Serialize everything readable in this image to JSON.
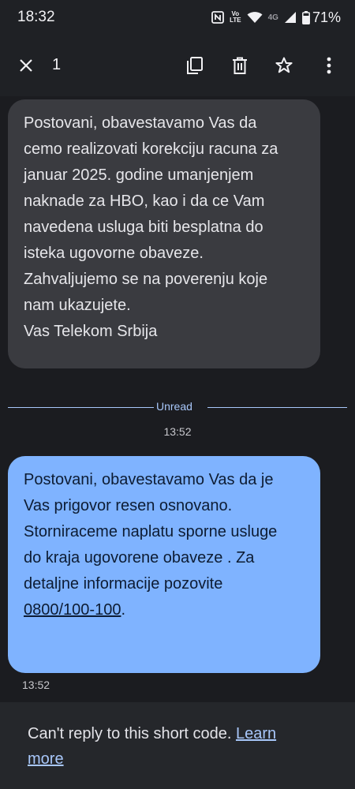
{
  "status_bar": {
    "time": "18:32",
    "volte_top": "Vo",
    "volte_bottom": "LTE",
    "network": "4G",
    "battery": "71%"
  },
  "toolbar": {
    "selected_count": "1",
    "icons": [
      "close-icon",
      "copy-icon",
      "delete-icon",
      "star-icon",
      "more-vert-icon"
    ]
  },
  "messages": {
    "incoming": {
      "lines": [
        "Postovani, obavestavamo Vas da",
        "cemo realizovati korekciju racuna za",
        "januar 2025. godine umanjenjem",
        "naknade za HBO, kao i da ce Vam",
        "navedena usluga biti besplatna do",
        "isteka ugovorne obaveze.",
        "Zahvaljujemo se na poverenju koje",
        "nam ukazujete.",
        "Vas Telekom Srbija"
      ]
    },
    "unread_label": "Unread",
    "unread_time": "13:52",
    "selected": {
      "lines": [
        "Postovani, obavestavamo Vas da je",
        "Vas prigovor  resen osnovano.",
        "Storniraceme naplatu sporne usluge",
        "do kraja ugovorene obaveze . Za",
        "detaljne informacije pozovite"
      ],
      "phone": "0800/100-100",
      "phone_suffix": ".",
      "time": "13:52"
    }
  },
  "footer": {
    "text": "Can't reply to this short code. ",
    "link_part1": "Learn",
    "link_part2": "more"
  },
  "colors": {
    "background": "#1b1c20",
    "bubble_incoming": "#3a3b40",
    "bubble_selected": "#7fb3ff",
    "accent": "#a8c7fa"
  }
}
